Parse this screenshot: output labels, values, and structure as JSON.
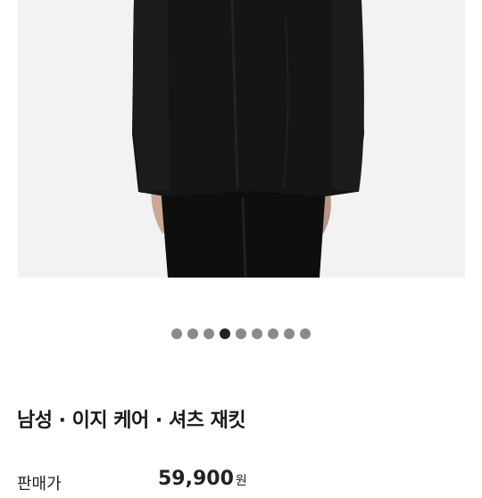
{
  "product": {
    "image_alt_icon": "product-photo",
    "carousel": {
      "total": 9,
      "active_index": 3
    },
    "title": "남성 · 이지 케어 · 셔츠 재킷",
    "price_label": "판매가",
    "price_value": "59,900",
    "price_unit": "원"
  },
  "colors": {
    "image_bg": "#f2f2f3",
    "garment": "#141414",
    "dot": "#8a8a8e",
    "dot_active": "#222222"
  }
}
